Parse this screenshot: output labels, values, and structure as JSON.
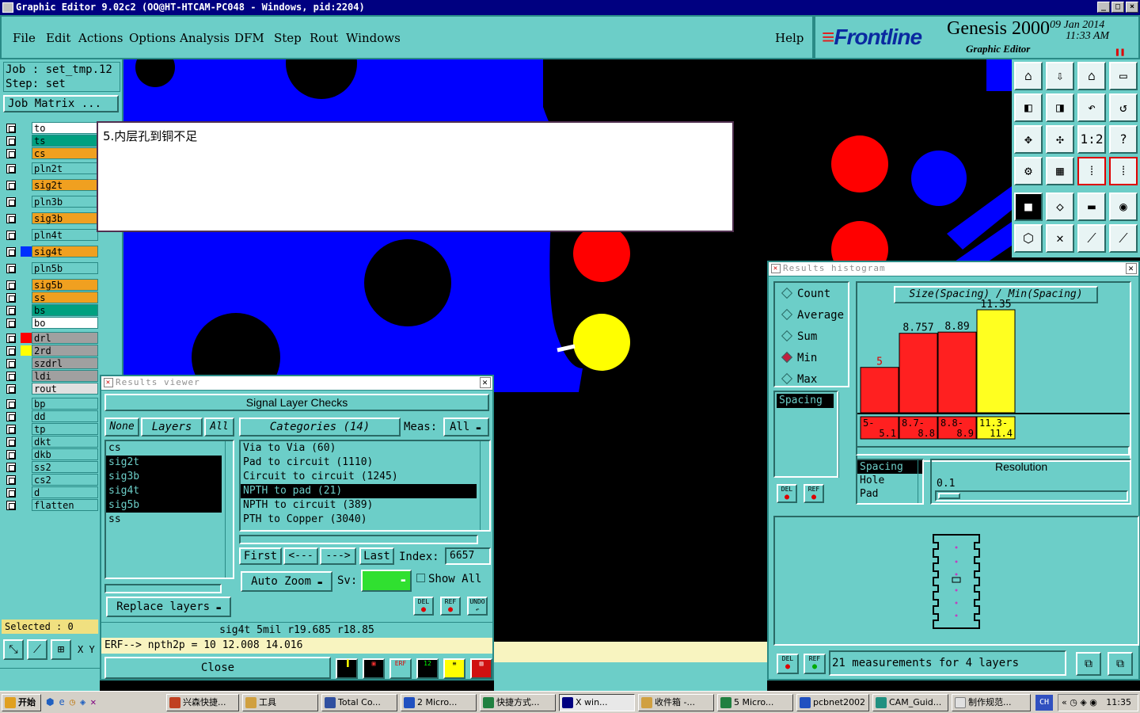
{
  "window": {
    "title": "Graphic Editor 9.02c2  (OO@HT-HTCAM-PC048 - Windows, pid:2204)"
  },
  "menu": [
    "File",
    "Edit",
    "Actions",
    "Options",
    "Analysis",
    "DFM",
    "Step",
    "Rout",
    "Windows"
  ],
  "help": "Help",
  "brand": {
    "logo": "Frontline",
    "product": "Genesis 2000",
    "subtitle": "Graphic Editor",
    "date": "09  Jan  2014",
    "time": "11:33  AM"
  },
  "job": {
    "job_line": "Job : set_tmp.12",
    "step_line": "Step: set",
    "matrix_button": "Job Matrix ..."
  },
  "layers": [
    {
      "name": "to",
      "color": "#ffffff",
      "swatch": "#6ccec8"
    },
    {
      "name": "ts",
      "color": "#00a080",
      "swatch": "#6ccec8"
    },
    {
      "name": "cs",
      "color": "#f0a020",
      "swatch": "#6ccec8"
    },
    {
      "name": "pln2t",
      "color": "#6ccec8",
      "swatch": "#6ccec8"
    },
    {
      "name": "sig2t",
      "color": "#f0a020",
      "swatch": "#6ccec8"
    },
    {
      "name": "pln3b",
      "color": "#6ccec8",
      "swatch": "#6ccec8"
    },
    {
      "name": "sig3b",
      "color": "#f0a020",
      "swatch": "#6ccec8"
    },
    {
      "name": "pln4t",
      "color": "#6ccec8",
      "swatch": "#6ccec8"
    },
    {
      "name": "sig4t",
      "color": "#f0a020",
      "swatch": "#0030ff"
    },
    {
      "name": "pln5b",
      "color": "#6ccec8",
      "swatch": "#6ccec8"
    },
    {
      "name": "sig5b",
      "color": "#f0a020",
      "swatch": "#6ccec8"
    },
    {
      "name": "ss",
      "color": "#f0a020",
      "swatch": "#6ccec8"
    },
    {
      "name": "bs",
      "color": "#00a080",
      "swatch": "#6ccec8"
    },
    {
      "name": "bo",
      "color": "#ffffff",
      "swatch": "#6ccec8"
    },
    {
      "name": "drl",
      "color": "#a0a0a0",
      "swatch": "#ff0000"
    },
    {
      "name": "2rd",
      "color": "#a0a0a0",
      "swatch": "#ffff00"
    },
    {
      "name": "szdrl",
      "color": "#a0a0a0",
      "swatch": "#6ccec8"
    },
    {
      "name": "ldi",
      "color": "#a0a0a0",
      "swatch": "#6ccec8"
    },
    {
      "name": "rout",
      "color": "#e0e0e0",
      "swatch": "#6ccec8"
    },
    {
      "name": "bp",
      "color": "#6ccec8",
      "swatch": "#6ccec8"
    },
    {
      "name": "dd",
      "color": "#6ccec8",
      "swatch": "#6ccec8"
    },
    {
      "name": "tp",
      "color": "#6ccec8",
      "swatch": "#6ccec8"
    },
    {
      "name": "dkt",
      "color": "#6ccec8",
      "swatch": "#6ccec8"
    },
    {
      "name": "dkb",
      "color": "#6ccec8",
      "swatch": "#6ccec8"
    },
    {
      "name": "ss2",
      "color": "#6ccec8",
      "swatch": "#6ccec8"
    },
    {
      "name": "cs2",
      "color": "#6ccec8",
      "swatch": "#6ccec8"
    },
    {
      "name": "d",
      "color": "#6ccec8",
      "swatch": "#6ccec8"
    },
    {
      "name": "flatten",
      "color": "#6ccec8",
      "swatch": "#6ccec8"
    }
  ],
  "selected": "Selected : 0",
  "xy": "X Y",
  "note": "5.内层孔到铜不足",
  "results_viewer": {
    "title": "Results viewer",
    "header": "Signal Layer Checks",
    "none": "None",
    "layers": "Layers",
    "all": "All",
    "layer_items": [
      {
        "name": "cs",
        "sel": false
      },
      {
        "name": "sig2t",
        "sel": true
      },
      {
        "name": "sig3b",
        "sel": true
      },
      {
        "name": "sig4t",
        "sel": true
      },
      {
        "name": "sig5b",
        "sel": true
      },
      {
        "name": "ss",
        "sel": false
      }
    ],
    "categories": "Categories (14)",
    "meas_label": "Meas:",
    "meas_value": "All",
    "cat_items": [
      {
        "name": "Via to Via (60)",
        "sel": false
      },
      {
        "name": "Pad to circuit (1110)",
        "sel": false
      },
      {
        "name": "Circuit to circuit (1245)",
        "sel": false
      },
      {
        "name": "NPTH to pad (21)",
        "sel": true
      },
      {
        "name": "NPTH to circuit (389)",
        "sel": false
      },
      {
        "name": "PTH to Copper (3040)",
        "sel": false
      }
    ],
    "first": "First",
    "prev": "<---",
    "next": "--->",
    "last": "Last",
    "index_label": "Index:",
    "index_value": "6657",
    "auto_zoom": "Auto Zoom",
    "sv": "Sv:",
    "show_all": "Show All",
    "replace": "Replace layers",
    "info": "sig4t  5mil   r19.685  r18.85",
    "erf": "ERF--> npth2p = 10 12.008 14.016",
    "close": "Close",
    "del": "DEL",
    "ref": "REF",
    "undo": "UNDO"
  },
  "histogram": {
    "title": "Results histogram",
    "radios": [
      {
        "label": "Count",
        "on": false
      },
      {
        "label": "Average",
        "on": false
      },
      {
        "label": "Sum",
        "on": false
      },
      {
        "label": "Min",
        "on": true
      },
      {
        "label": "Max",
        "on": false
      }
    ],
    "list_sel": "Spacing",
    "chart_title": "Size(Spacing) / Min(Spacing)",
    "res_list": [
      "Spacing",
      "Hole",
      "Pad"
    ],
    "resolution_label": "Resolution",
    "resolution_value": "0.1",
    "summary": "21 measurements for 4 layers",
    "del": "DEL",
    "ref": "REF"
  },
  "chart_data": {
    "type": "bar",
    "title": "Size(Spacing) / Min(Spacing)",
    "categories": [
      "5-5.1",
      "8.7-8.8",
      "8.8-8.9",
      "11.3-11.4"
    ],
    "values": [
      5,
      8.757,
      8.89,
      11.35
    ],
    "value_labels": [
      "5",
      "8.757",
      "8.89",
      "11.35"
    ],
    "colors": [
      "#ff2020",
      "#ff2020",
      "#ff2020",
      "#ffff20"
    ],
    "ylim": [
      0,
      11.35
    ]
  },
  "taskbar": {
    "start": "开始",
    "items": [
      "兴森快捷...",
      "工具",
      "Total Co...",
      "2 Micro...",
      "快捷方式...",
      "X win...",
      "收件箱 -...",
      "5 Micro...",
      "pcbnet2002",
      "CAM_Guid...",
      "制作规范..."
    ],
    "lang": "CH",
    "clock": "11:35"
  }
}
